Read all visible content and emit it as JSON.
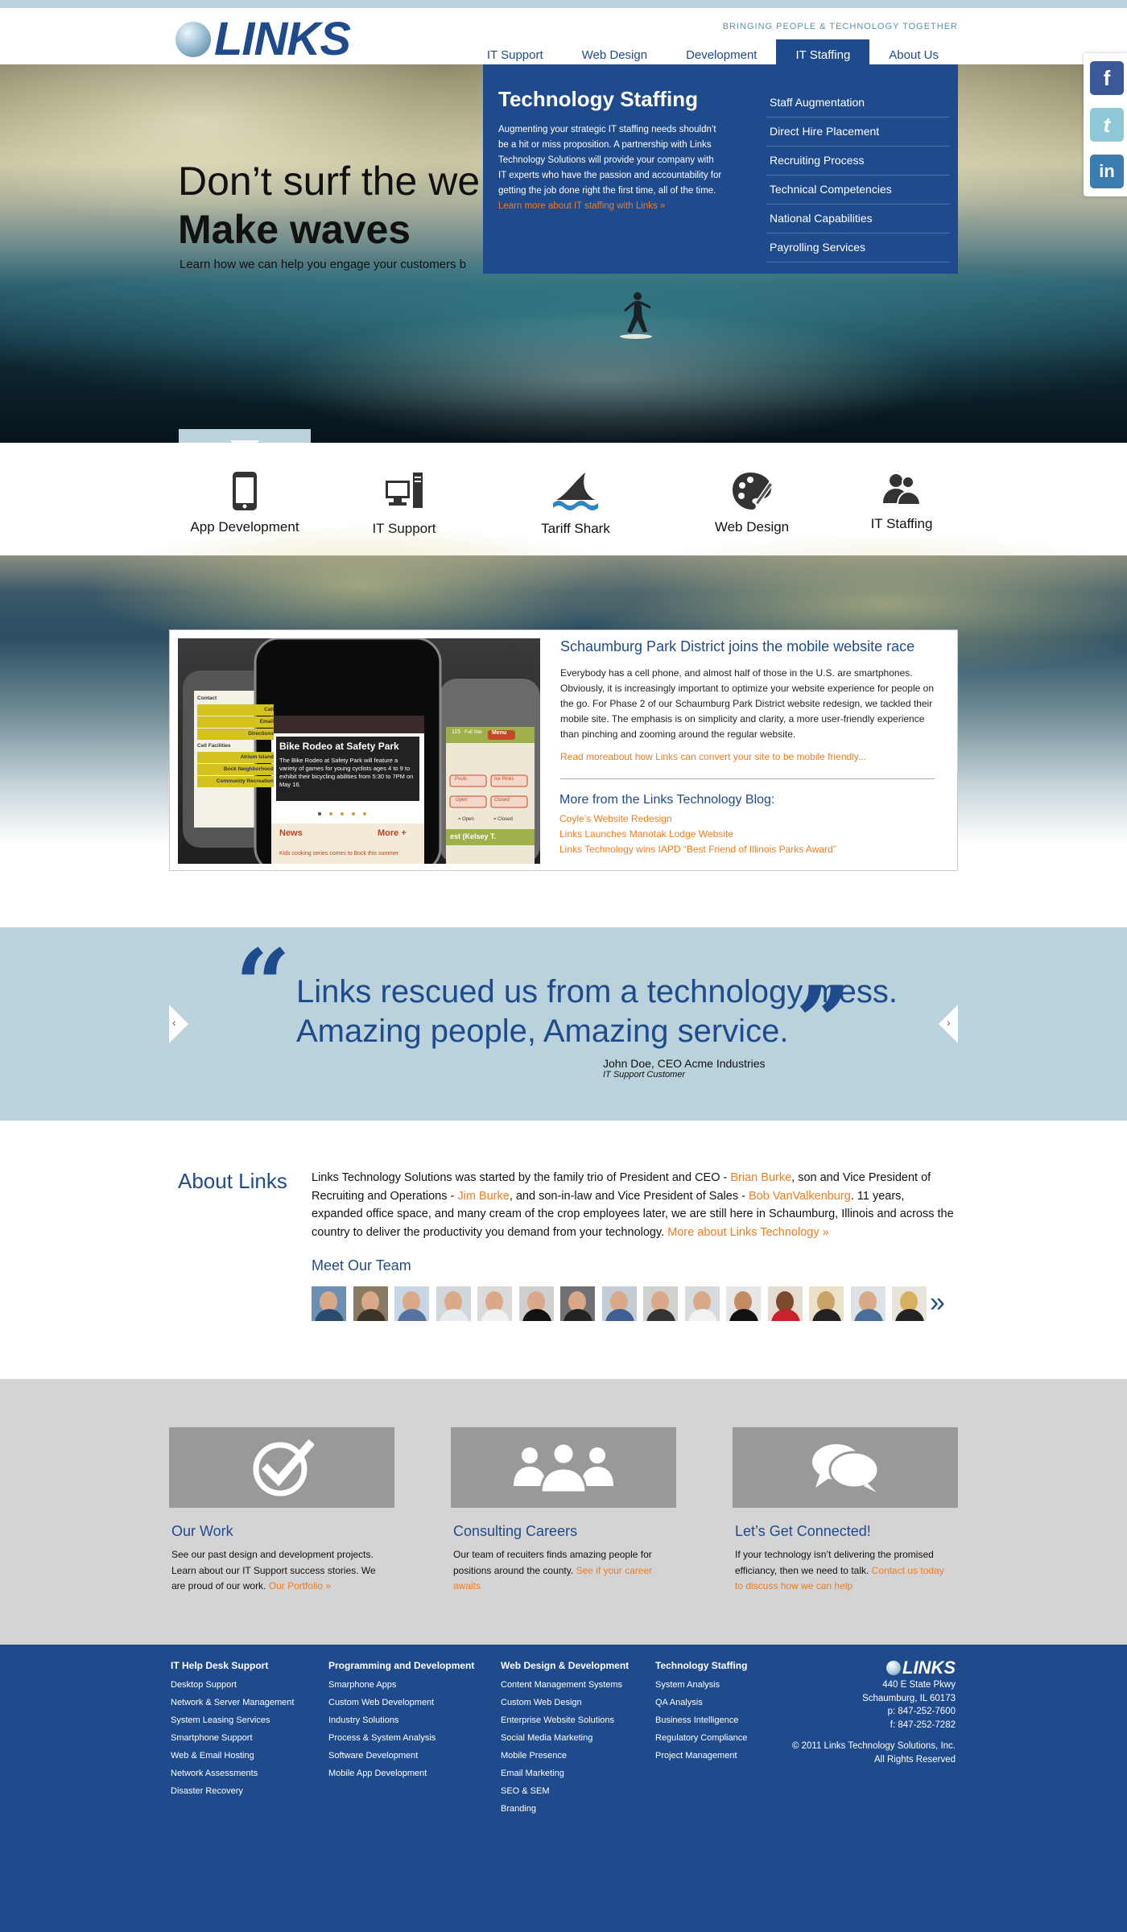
{
  "header": {
    "logo_text": "LINKS",
    "tagline": "BRINGING PEOPLE & TECHNOLOGY TOGETHER",
    "nav": [
      "IT Support",
      "Web Design",
      "Development",
      "IT Staffing",
      "About Us"
    ],
    "active_nav": "IT Staffing"
  },
  "hero": {
    "line1": "Don’t surf the we",
    "line2": "Make waves",
    "sub": "Learn how we can help you engage your customers b"
  },
  "dropdown": {
    "title": "Technology Staffing",
    "text": "Augmenting your strategic IT staffing needs shouldn’t be a hit or miss proposition. A partnership with Links Technology Solutions will provide your company with IT experts who have the passion and accountability for getting the job done right the first time, all of the time.",
    "more": "Learn more about IT staffing with Links »",
    "items": [
      "Staff Augmentation",
      "Direct Hire Placement",
      "Recruiting Process",
      "Technical Competencies",
      "National Capabilities",
      "Payrolling Services"
    ]
  },
  "social": {
    "facebook": "f",
    "twitter": "t",
    "linkedin": "in"
  },
  "services": [
    "App Development",
    "IT Support",
    "Tariff Shark",
    "Web Design",
    "IT Staffing"
  ],
  "news": {
    "phone": {
      "headline": "Bike Rodeo at Safety Park",
      "text": "The Bike Rodeo at Safety Park will feature a variety of games for young cyclists ages 4 to 9 to exhibit their bicycling abilities from 5:30 to 7PM on May 16.",
      "news": "News",
      "more": "More +",
      "footer": "Kids cooking series comes to Bock this summer",
      "left_items": [
        "Contact",
        "Call",
        "Email",
        "Directions",
        "Cell Facilities",
        "Atrium Island",
        "Bock Neighborhood",
        "Community Recreation"
      ],
      "right_items": [
        "Pools",
        "Ice Rinks",
        "Open",
        "Closed"
      ],
      "right_labels": [
        "115",
        "Full Site",
        "Menu",
        "est (Kelsey T."
      ],
      "legend": [
        "= Open",
        "= Closed"
      ]
    },
    "title": "Schaumburg Park District joins the mobile website race",
    "body": "Everybody has a cell phone, and almost half of those in the U.S. are smartphones. Obviously, it is increasingly important to optimize your website experience for people on the go. For Phase 2 of our Schaumburg Park District website redesign, we tackled their mobile site. The emphasis is on simplicity and clarity, a more user-friendly experience than pinching and zooming around the regular website.",
    "read_more": "Read moreabout how Links can convert your site to be mobile friendly...",
    "blog_title": "More from the Links Technology Blog:",
    "blog_links": [
      "Coyle’s Website Redesign",
      "Links Launches Manotak Lodge Website",
      "Links Technology wins IAPD “Best Friend of Illinois Parks Award”"
    ]
  },
  "testimonial": {
    "line1": "Links rescued us from a technology mess.",
    "line2": "Amazing people, Amazing service.",
    "author": "John Doe, CEO Acme Industries",
    "role": "IT Support Customer"
  },
  "about": {
    "title": "About Links",
    "t1": "Links Technology Solutions was started by the family trio of President and CEO - ",
    "n1": "Brian Burke",
    "t2": ", son and Vice President of Recruiting and Operations - ",
    "n2": "Jim Burke",
    "t3": ", and son-in-law and Vice President of Sales - ",
    "n3": "Bob VanValkenburg",
    "t4": ". 11 years, expanded office space, and many cream of the crop employees later, we are still here in Schaumburg, Illinois and across the country to deliver the productivity you demand from your technology. ",
    "more": "More about Links Technology »",
    "team_title": "Meet Our Team"
  },
  "promo": [
    {
      "title": "Our Work",
      "text": "See our past design and development projects. Learn about our IT Support success stories. We are proud of our work.",
      "link": "Our Portfolio »"
    },
    {
      "title": "Consulting Careers",
      "text": "Our team of recuiters finds amazing people for positions around the county.",
      "link": "See if your career awaits"
    },
    {
      "title": "Let’s Get Connected!",
      "text": "If your technology isn’t delivering the promised efficiancy, then we need to talk.",
      "link": "Contact us today to discuss how we can help"
    }
  ],
  "footer": {
    "columns": [
      {
        "title": "IT Help Desk Support",
        "items": [
          "Desktop Support",
          "Network & Server Management",
          "System Leasing Services",
          "Smartphone Support",
          "Web & Email Hosting",
          "Network Assessments",
          "Disaster Recovery"
        ]
      },
      {
        "title": "Programming and Development",
        "items": [
          "Smarphone Apps",
          "Custom Web Development",
          "Industry Solutions",
          "Process & System Analysis",
          "Software Development",
          "Mobile App Development"
        ]
      },
      {
        "title": "Web Design & Development",
        "items": [
          "Content Management Systems",
          "Custom Web Design",
          "Enterprise Website Solutions",
          "Social Media Marketing",
          "Mobile Presence",
          "Email Marketing",
          "SEO & SEM",
          "Branding"
        ]
      },
      {
        "title": "Technology Staffing",
        "items": [
          "System Analysis",
          "QA Analysis",
          "Business Intelligence",
          "Regulatory Compliance",
          "Project Management"
        ]
      }
    ],
    "logo_text": "LINKS",
    "address1": "440 E State Pkwy",
    "address2": "Schaumburg, IL 60173",
    "phone": "p: 847-252-7600",
    "fax": "f: 847-252-7282",
    "copyright": "© 2011 Links Technology Solutions, Inc.",
    "rights": "All Rights Reserved"
  },
  "colors": {
    "brand": "#1f4b8c",
    "accent": "#f37b1d",
    "light_band": "#b9d2dc"
  }
}
